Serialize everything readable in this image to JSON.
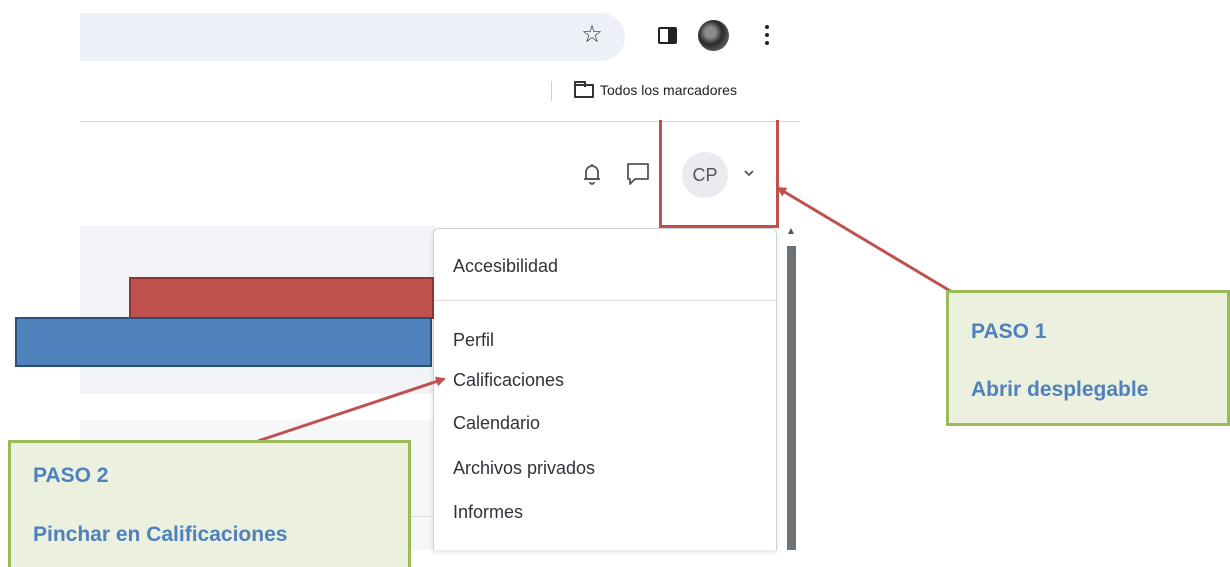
{
  "browser": {
    "bookmarks_label": "Todos los marcadores",
    "star_icon": "star-icon",
    "sidepanel_icon": "side-panel-icon",
    "menu_icon": "kebab-menu-icon"
  },
  "header": {
    "avatar_initials": "CP",
    "bell_icon": "bell-icon",
    "chat_icon": "chat-icon"
  },
  "dropdown": {
    "items": [
      {
        "label": "Accesibilidad"
      },
      {
        "label": "Perfil"
      },
      {
        "label": "Calificaciones"
      },
      {
        "label": "Calendario"
      },
      {
        "label": "Archivos privados"
      },
      {
        "label": "Informes"
      }
    ]
  },
  "annotations": {
    "step1": {
      "title": "PASO 1",
      "text": "Abrir desplegable"
    },
    "step2": {
      "title": "PASO 2",
      "text": "Pinchar en Calificaciones"
    },
    "colors": {
      "red": "#c0504d",
      "blue": "#4f81bd",
      "green": "#9bbb59",
      "callout_bg": "#ebf1de"
    }
  }
}
